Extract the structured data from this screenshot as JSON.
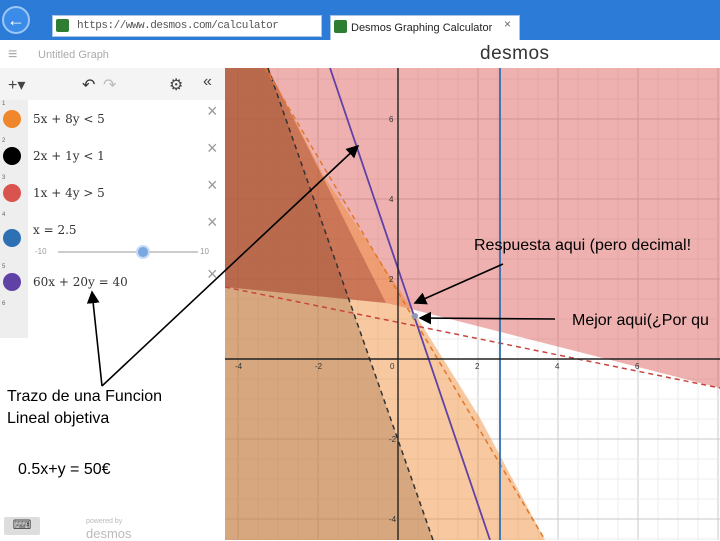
{
  "browser": {
    "url": "https://www.desmos.com/calculator",
    "tab_title": "Desmos Graphing Calculator",
    "tab_close": "×",
    "back": "←"
  },
  "header": {
    "menu_icon": "≡",
    "graph_title": "Untitled Graph",
    "logo": "desmos"
  },
  "toolbar": {
    "add": "+▾",
    "undo": "↶",
    "redo": "↷",
    "settings": "⚙",
    "collapse": "«"
  },
  "expressions": [
    {
      "num": "1",
      "latex": "5x + 8y < 5",
      "color": "#f0872c"
    },
    {
      "num": "2",
      "latex": "2x + 1y < 1",
      "color": "#000000"
    },
    {
      "num": "3",
      "latex": "1x + 4y > 5",
      "color": "#d9534f"
    },
    {
      "num": "4",
      "latex": "x = 2.5",
      "color": "#2d70b3"
    },
    {
      "num": "5",
      "latex": "60x + 20y = 40",
      "color": "#6042a6"
    },
    {
      "num": "6",
      "latex": ""
    }
  ],
  "slider": {
    "min": "-10",
    "max": "10",
    "value": 2.5
  },
  "delete_symbol": "×",
  "footer": {
    "keyboard": "⌨",
    "powered_by": "powered by",
    "powered_logo": "desmos"
  },
  "graph": {
    "x_ticks": [
      "-4",
      "-2",
      "0",
      "2",
      "4",
      "6"
    ],
    "y_ticks_pos": [
      "6",
      "4",
      "2"
    ],
    "y_ticks_neg": [
      "-2",
      "-4"
    ]
  },
  "annotations": {
    "respuesta": "Respuesta aqui (pero decimal!",
    "mejor": "Mejor aqui(¿Por qu",
    "trazo_line1": "Trazo de una Funcion",
    "trazo_line2": "Lineal objetiva",
    "formula": "0.5x+y = 50€"
  },
  "colors": {
    "chrome_blue": "#2c7bd6",
    "orange": "#f0872c",
    "red": "#c74440",
    "blue": "#2d70b3",
    "purple": "#6042a6"
  }
}
